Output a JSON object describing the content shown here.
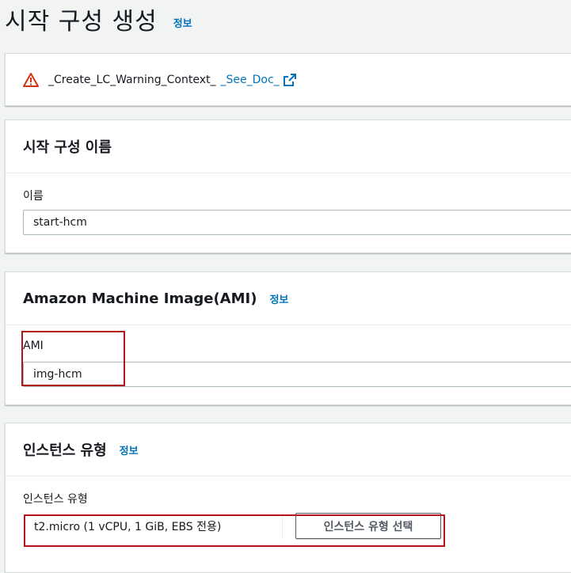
{
  "header": {
    "title": "시작 구성 생성",
    "info_label": "정보"
  },
  "warning": {
    "text": "_Create_LC_Warning_Context_",
    "link_text": "_See_Doc_",
    "icon": "warning-triangle-icon",
    "icon_color": "#d13212"
  },
  "name_section": {
    "title": "시작 구성 이름",
    "field_label": "이름",
    "field_value": "start-hcm"
  },
  "ami_section": {
    "title": "Amazon Machine Image(AMI)",
    "info_label": "정보",
    "field_label": "AMI",
    "field_value": "img-hcm"
  },
  "instance_section": {
    "title": "인스턴스 유형",
    "info_label": "정보",
    "field_label": "인스턴스 유형",
    "selected_type": "t2.micro (1 vCPU, 1 GiB, EBS 전용)",
    "select_button_label": "인스턴스 유형 선택"
  },
  "colors": {
    "link": "#0073bb",
    "highlight": "#b0161c",
    "background": "#f2f3f3"
  }
}
